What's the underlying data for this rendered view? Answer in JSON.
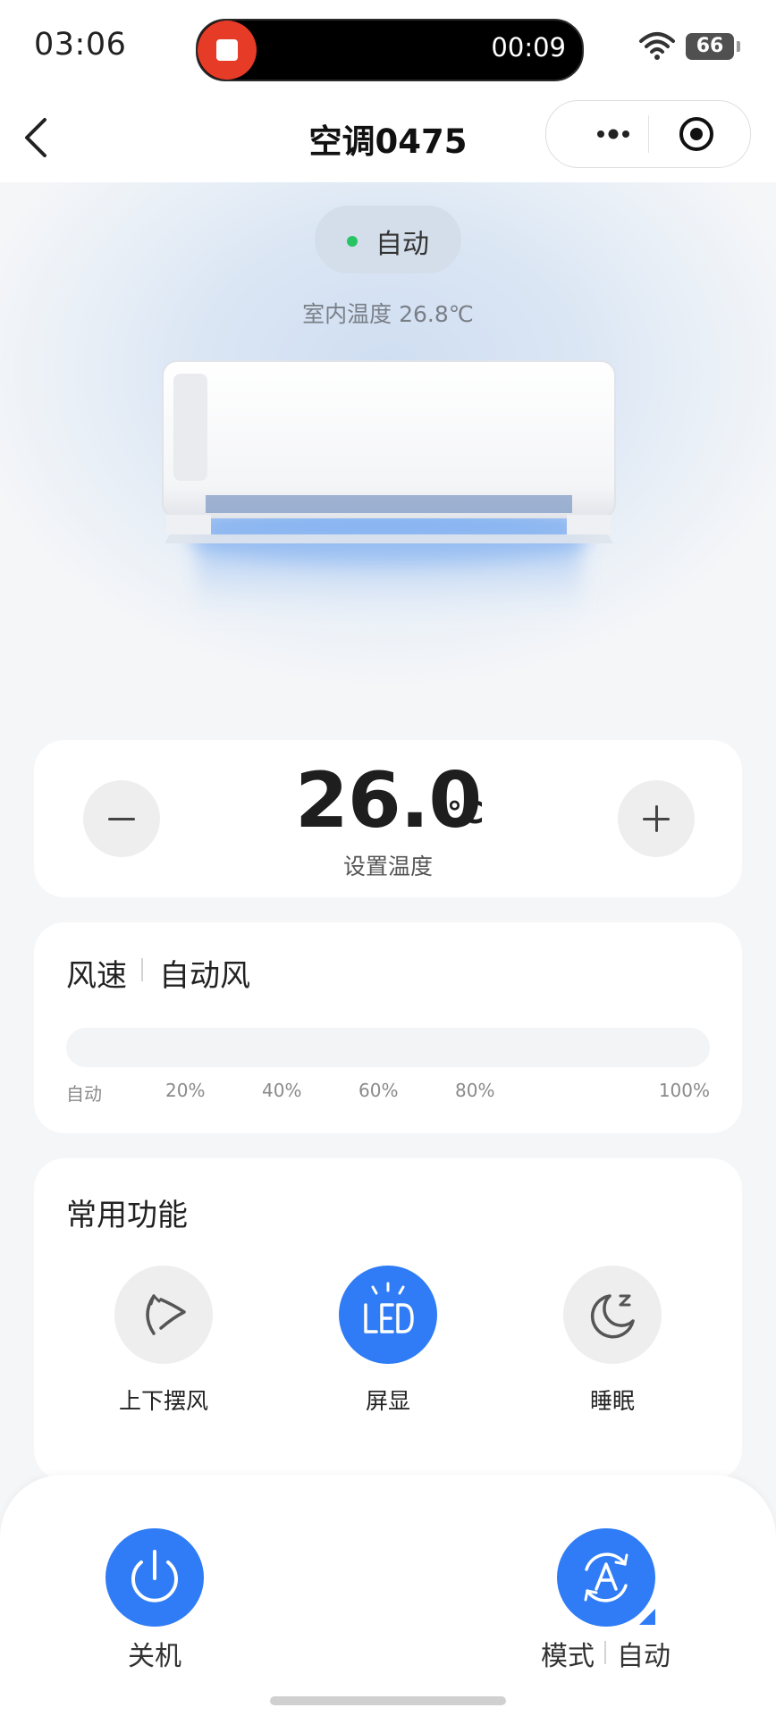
{
  "status_bar": {
    "time": "03:06",
    "recording_timer": "00:09",
    "battery": "66"
  },
  "nav": {
    "title": "空调0475"
  },
  "hero": {
    "mode_status": "自动",
    "indoor_temp": "室内温度 26.8℃"
  },
  "temperature": {
    "value": "26.0",
    "unit": "℃",
    "label": "设置温度"
  },
  "fan": {
    "title": "风速",
    "value": "自动风",
    "level_percent": 0,
    "scale": [
      "自动",
      "20%",
      "40%",
      "60%",
      "80%",
      "100%"
    ]
  },
  "functions": {
    "title": "常用功能",
    "items": [
      {
        "label": "上下摆风",
        "icon": "swing-icon",
        "active": false
      },
      {
        "label": "屏显",
        "icon": "led-display-icon",
        "active": true
      },
      {
        "label": "睡眠",
        "icon": "sleep-icon",
        "active": false
      }
    ]
  },
  "bottom": {
    "power_label": "关机",
    "mode_label": "模式",
    "mode_value": "自动"
  },
  "colors": {
    "accent": "#2f7cf6",
    "status_dot": "#28c463",
    "record": "#e63b27"
  }
}
